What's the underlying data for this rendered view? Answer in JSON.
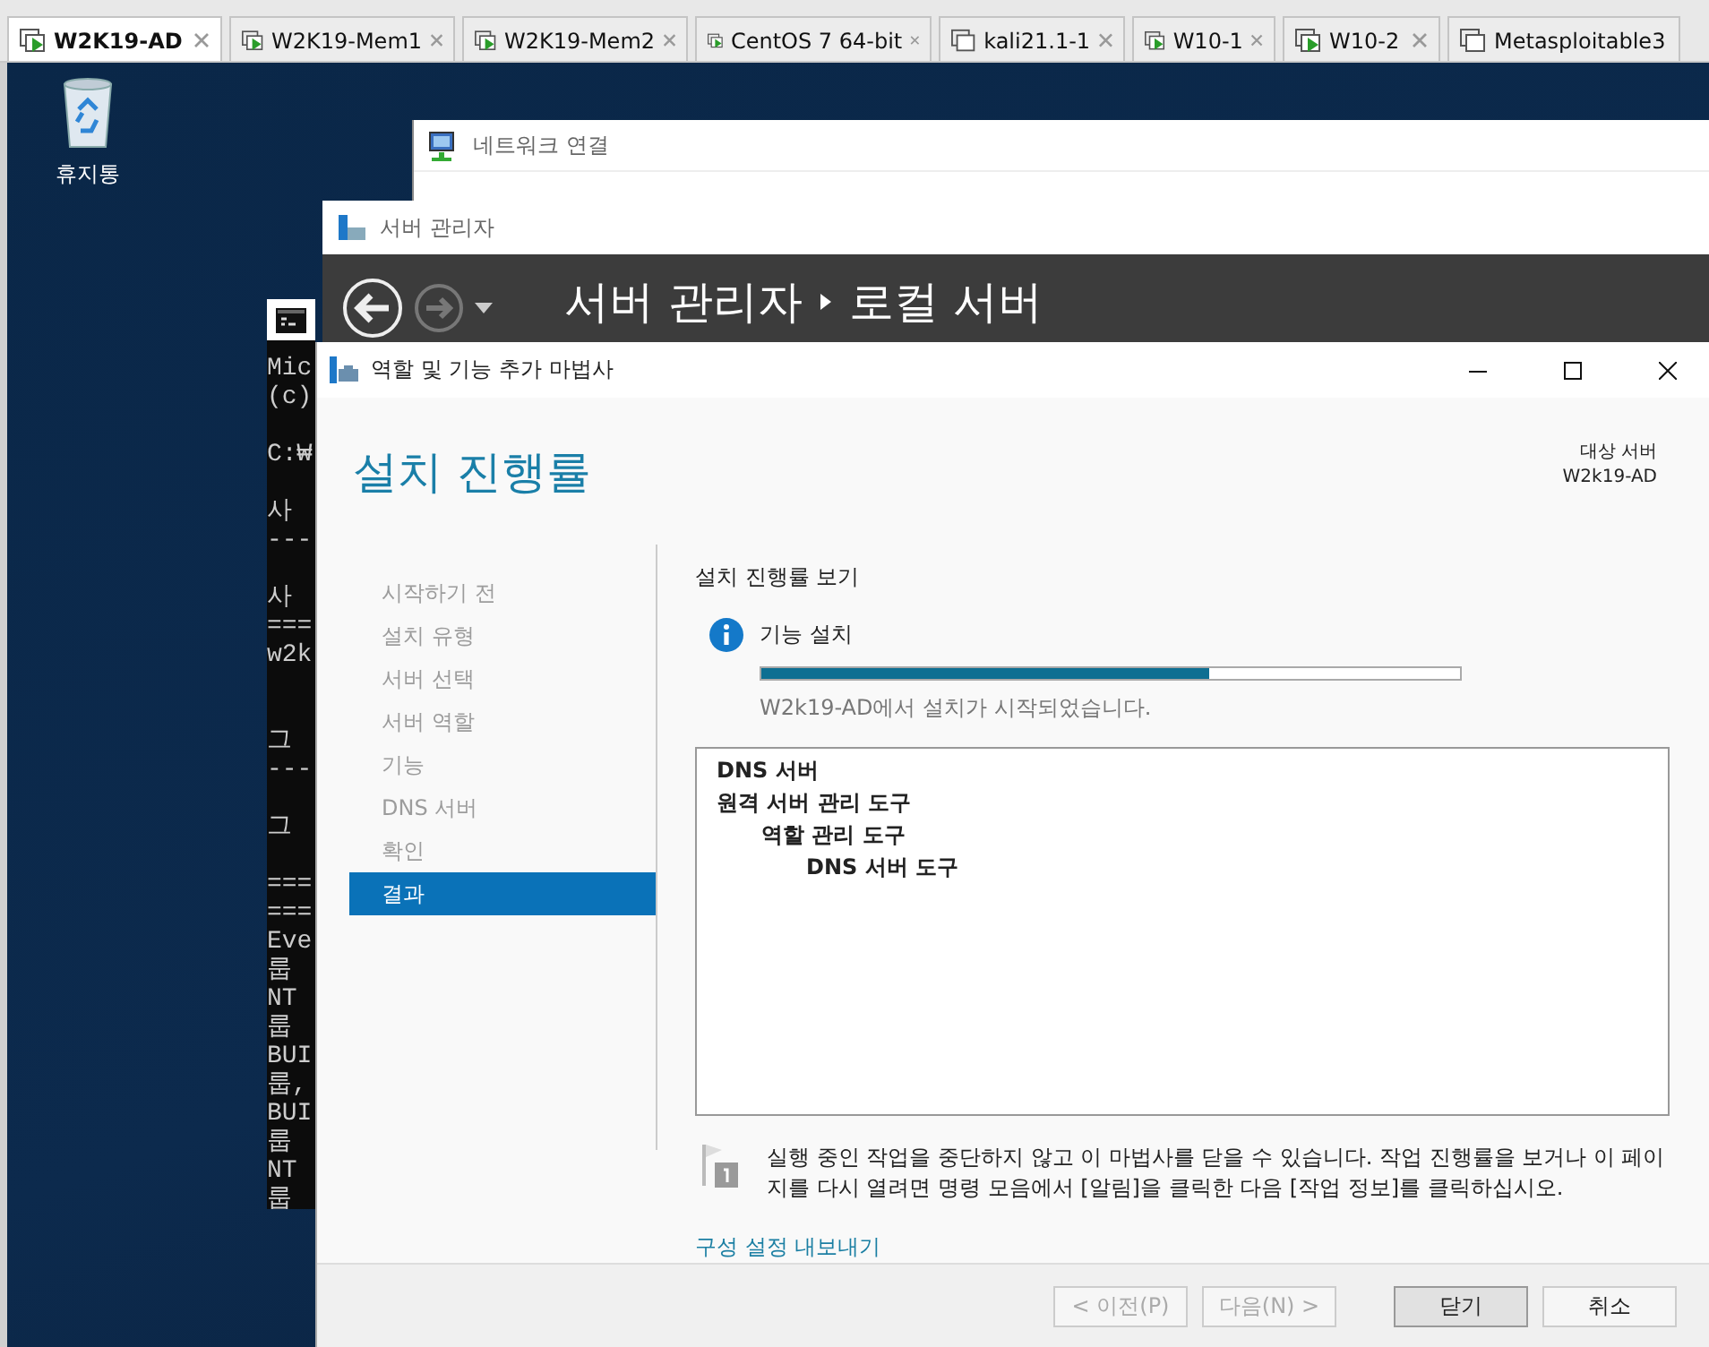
{
  "vm_tabs": [
    {
      "label": "W2K19-AD",
      "selected": true,
      "running": true,
      "closable": true
    },
    {
      "label": "W2K19-Mem1",
      "selected": false,
      "running": true,
      "closable": true
    },
    {
      "label": "W2K19-Mem2",
      "selected": false,
      "running": true,
      "closable": true
    },
    {
      "label": "CentOS 7 64-bit",
      "selected": false,
      "running": true,
      "closable": true
    },
    {
      "label": "kali21.1-1",
      "selected": false,
      "running": false,
      "closable": true
    },
    {
      "label": "W10-1",
      "selected": false,
      "running": true,
      "closable": true
    },
    {
      "label": "W10-2",
      "selected": false,
      "running": true,
      "closable": true
    },
    {
      "label": "Metasploitable3",
      "selected": false,
      "running": false,
      "closable": false
    }
  ],
  "desktop_icons": [
    {
      "label": "휴지통"
    }
  ],
  "network_window": {
    "title": "네트워크 연결"
  },
  "console_window": {
    "lines": [
      {
        "kind": "text",
        "text": "Mic"
      },
      {
        "kind": "text",
        "text": "(c)"
      },
      {
        "kind": "blank"
      },
      {
        "kind": "text",
        "text": "C:₩"
      },
      {
        "kind": "blank"
      },
      {
        "kind": "text",
        "text": "사"
      },
      {
        "kind": "text",
        "text": "---"
      },
      {
        "kind": "blank"
      },
      {
        "kind": "text",
        "text": "사"
      },
      {
        "kind": "text",
        "text": "==="
      },
      {
        "kind": "text",
        "text": "w2k"
      },
      {
        "kind": "blank"
      },
      {
        "kind": "blank"
      },
      {
        "kind": "text",
        "text": "그"
      },
      {
        "kind": "text",
        "text": "---"
      },
      {
        "kind": "blank"
      },
      {
        "kind": "text",
        "text": "그"
      },
      {
        "kind": "blank"
      },
      {
        "kind": "text",
        "text": "==="
      },
      {
        "kind": "text",
        "text": "==="
      },
      {
        "kind": "text",
        "text": "Eve"
      },
      {
        "kind": "text",
        "text": "룹"
      },
      {
        "kind": "text",
        "text": "NT"
      },
      {
        "kind": "text",
        "text": "룹"
      },
      {
        "kind": "text",
        "text": "BUI"
      },
      {
        "kind": "text",
        "text": "룹,"
      },
      {
        "kind": "text",
        "text": "BUI"
      },
      {
        "kind": "text",
        "text": "룹"
      },
      {
        "kind": "text",
        "text": "NT"
      },
      {
        "kind": "text",
        "text": "룹"
      }
    ]
  },
  "server_manager": {
    "title": "서버 관리자",
    "breadcrumb": [
      "서버 관리자",
      "로컬 서버"
    ]
  },
  "wizard": {
    "title": "역할 및 기능 추가 마법사",
    "heading": "설치 진행률",
    "target_label": "대상 서버",
    "target_server": "W2k19-AD",
    "steps": [
      {
        "label": "시작하기 전",
        "selected": false
      },
      {
        "label": "설치 유형",
        "selected": false
      },
      {
        "label": "서버 선택",
        "selected": false
      },
      {
        "label": "서버 역할",
        "selected": false
      },
      {
        "label": "기능",
        "selected": false
      },
      {
        "label": "DNS 서버",
        "selected": false
      },
      {
        "label": "확인",
        "selected": false
      },
      {
        "label": "결과",
        "selected": true
      }
    ],
    "section_title": "설치 진행률 보기",
    "status_title": "기능 설치",
    "progress": {
      "level": 0.64
    },
    "status_message": "W2k19-AD에서 설치가 시작되었습니다.",
    "results": [
      {
        "label": "DNS 서버"
      },
      {
        "label": "원격 서버 관리 도구",
        "children": [
          {
            "label": "역할 관리 도구",
            "children": [
              {
                "label": "DNS 서버 도구"
              }
            ]
          }
        ]
      }
    ],
    "note": "실행 중인 작업을 중단하지 않고 이 마법사를 닫을 수 있습니다. 작업 진행률을 보거나 이 페이지를 다시 열려면 명령 모음에서 [알림]을 클릭한 다음 [작업 정보]를 클릭하십시오.",
    "export_link": "구성 설정 내보내기",
    "buttons": [
      {
        "label": "< 이전(P)",
        "disabled": true,
        "default": false
      },
      {
        "label": "다음(N) >",
        "disabled": true,
        "default": false
      },
      {
        "label": "닫기",
        "disabled": false,
        "default": true
      },
      {
        "label": "취소",
        "disabled": false,
        "default": false
      }
    ]
  }
}
